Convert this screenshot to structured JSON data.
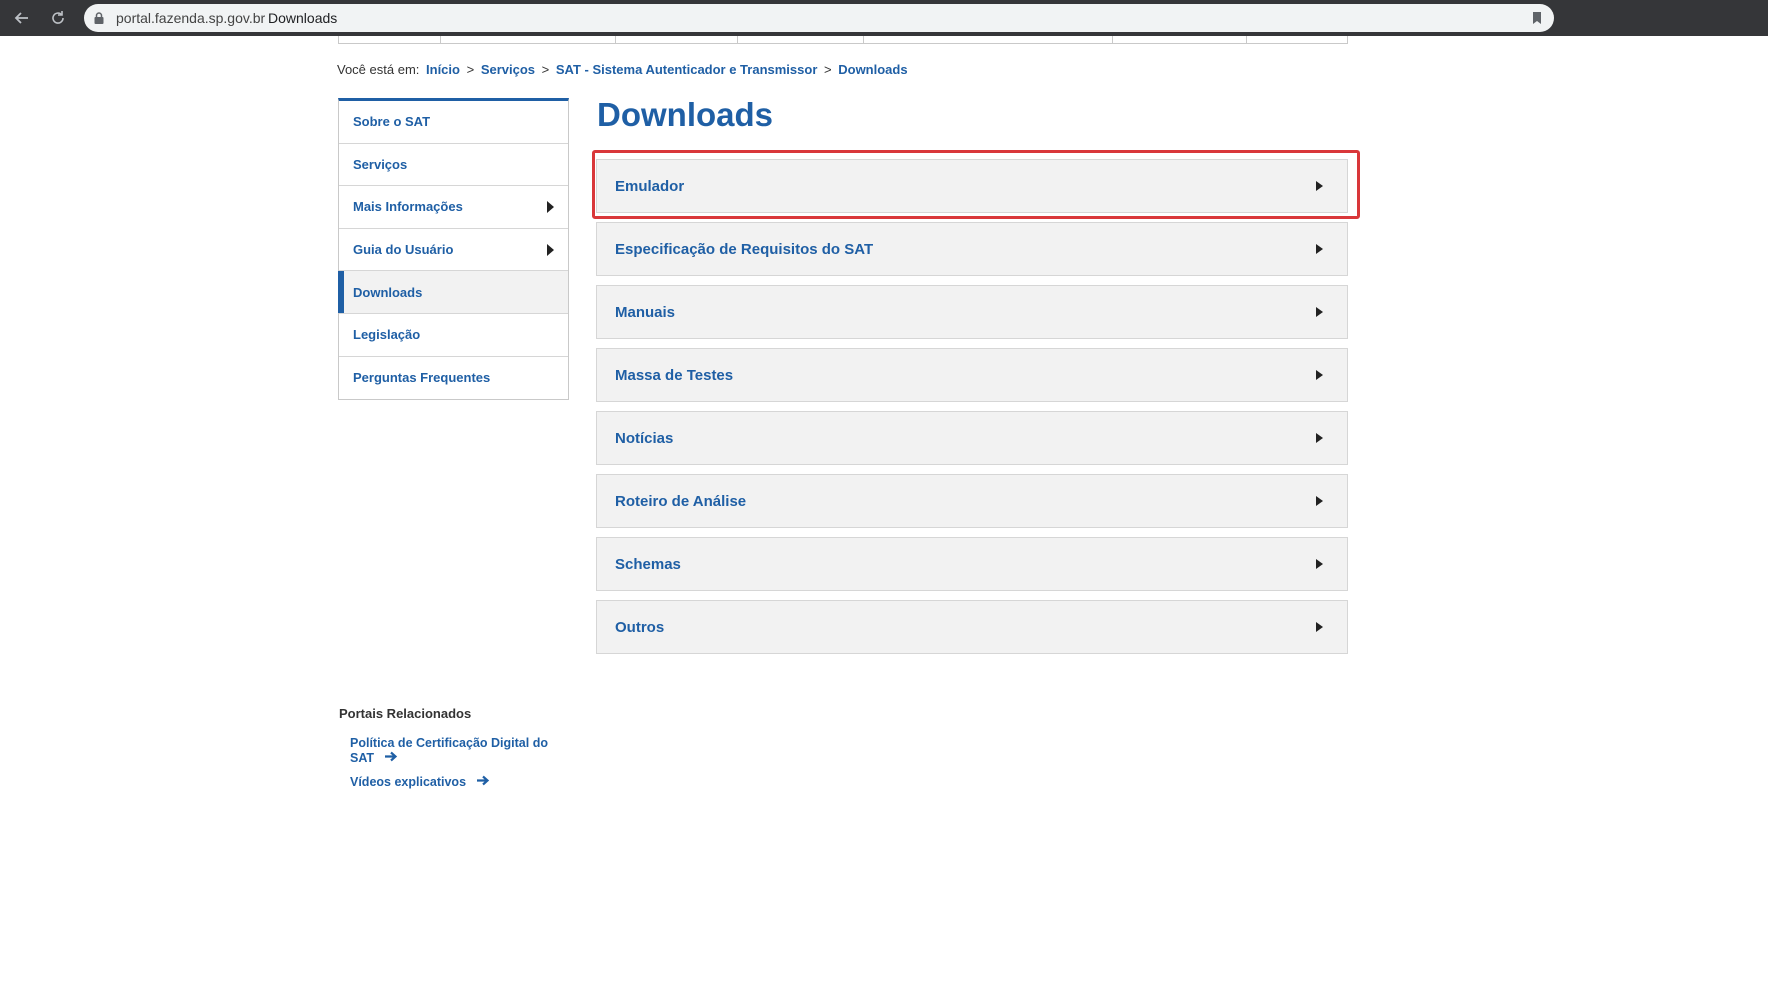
{
  "browser": {
    "url_host": "portal.fazenda.sp.gov.br",
    "page_title": "Downloads",
    "icons": [
      "back-arrow-icon",
      "reload-icon",
      "lock-icon",
      "bookmark-icon"
    ]
  },
  "breadcrumb": {
    "prefix": "Você está em:",
    "separator": ">",
    "items": [
      "Início",
      "Serviços",
      "SAT - Sistema Autenticador e Transmissor",
      "Downloads"
    ]
  },
  "sidebar": {
    "items": [
      {
        "label": "Sobre o SAT",
        "has_submenu": false,
        "active": false
      },
      {
        "label": "Serviços",
        "has_submenu": false,
        "active": false
      },
      {
        "label": "Mais Informações",
        "has_submenu": true,
        "active": false
      },
      {
        "label": "Guia do Usuário",
        "has_submenu": true,
        "active": false
      },
      {
        "label": "Downloads",
        "has_submenu": false,
        "active": true
      },
      {
        "label": "Legislação",
        "has_submenu": false,
        "active": false
      },
      {
        "label": "Perguntas Frequentes",
        "has_submenu": false,
        "active": false
      }
    ]
  },
  "main": {
    "title": "Downloads",
    "sections": [
      {
        "label": "Emulador",
        "highlighted": true
      },
      {
        "label": "Especificação de Requisitos do SAT",
        "highlighted": false
      },
      {
        "label": "Manuais",
        "highlighted": false
      },
      {
        "label": "Massa de Testes",
        "highlighted": false
      },
      {
        "label": "Notícias",
        "highlighted": false
      },
      {
        "label": "Roteiro de Análise",
        "highlighted": false
      },
      {
        "label": "Schemas",
        "highlighted": false
      },
      {
        "label": "Outros",
        "highlighted": false
      }
    ]
  },
  "related": {
    "title": "Portais Relacionados",
    "links": [
      {
        "line1": "Política de Certificação Digital do",
        "line2": "SAT"
      },
      {
        "line1": "Vídeos explicativos",
        "line2": ""
      }
    ]
  },
  "colors": {
    "accent": "#1f5fa5",
    "highlight": "#d9373a",
    "panel": "#f2f2f2"
  }
}
